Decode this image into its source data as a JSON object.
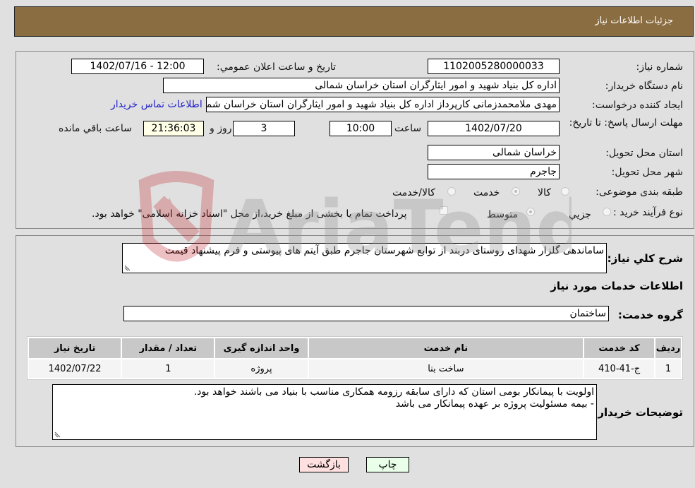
{
  "header": {
    "title": "جزئیات اطلاعات نیاز"
  },
  "form": {
    "need_number": {
      "label": "شماره نیاز:",
      "value": "1102005280000033"
    },
    "announce_datetime": {
      "label": "تاریخ و ساعت اعلان عمومي:",
      "value": "1402/07/16 - 12:00"
    },
    "buyer_org": {
      "label": "نام دستگاه خریدار:",
      "value": "اداره کل بنیاد شهید و امور ایثارگران استان خراسان شمالی"
    },
    "requester": {
      "label": "ایجاد کننده درخواست:",
      "value": "مهدی  ملامحمدزمانی کارپرداز اداره کل بنیاد شهید و امور ایثارگران استان خراسان شمالی"
    },
    "contact_link": "اطلاعات تماس خریدار",
    "deadline": {
      "label": "مهلت ارسال پاسخ: تا تاریخ:",
      "date": "1402/07/20",
      "time_label": "ساعت",
      "time": "10:00",
      "days": "3",
      "days_label": "روز و",
      "remaining": "21:36:03",
      "remaining_label": "ساعت باقي مانده"
    },
    "province": {
      "label": "استان محل تحویل:",
      "value": "خراسان شمالی"
    },
    "city": {
      "label": "شهر محل تحویل:",
      "value": "جاجرم"
    },
    "category": {
      "label": "طبقه بندی موضوعی:",
      "options": [
        "کالا",
        "خدمت",
        "کالا/خدمت"
      ],
      "selected": "خدمت"
    },
    "process": {
      "label": "نوع فرآیند خرید :",
      "options": [
        "جزیي",
        "متوسط"
      ],
      "selected": "متوسط",
      "treasury_checkbox_label": "پرداخت تمام یا بخشی از مبلغ خرید،از محل \"اسناد خزانه اسلامی\" خواهد بود."
    }
  },
  "details": {
    "description_label": "شرح کلي نیاز:",
    "description": "ساماندهی گلزار شهدای روستای دربند از توابع شهرستان جاجرم طبق آیتم های پیوستی و فرم پیشنهاد قیمت",
    "services_heading": "اطلاعات خدمات مورد نیاز",
    "service_group_label": "گروه خدمت:",
    "service_group": "ساختمان",
    "table": {
      "headers": [
        "ردیف",
        "کد خدمت",
        "نام خدمت",
        "واحد اندازه گیری",
        "تعداد / مقدار",
        "تاریخ نیاز"
      ],
      "rows": [
        [
          "1",
          "ج-41-410",
          "ساخت بنا",
          "پروژه",
          "1",
          "1402/07/22"
        ]
      ]
    },
    "buyer_notes_label": "توضیحات خریدار:",
    "buyer_notes_line1": "اولویت با پیمانکار بومی استان که دارای سابقه رزومه همکاری مناسب با بنیاد می باشند خواهد بود.",
    "buyer_notes_line2": "- بیمه مسئولیت پروژه بر عهده پیمانکار می باشد"
  },
  "buttons": {
    "print": "چاپ",
    "back": "بازگشت"
  },
  "watermark": {
    "text": "AriaTender.neT"
  },
  "colors": {
    "header_bg": "#8b6d42",
    "print_bg": "#eaffea",
    "back_bg": "#ffe0e0",
    "remaining_bg": "#ffffe8"
  }
}
